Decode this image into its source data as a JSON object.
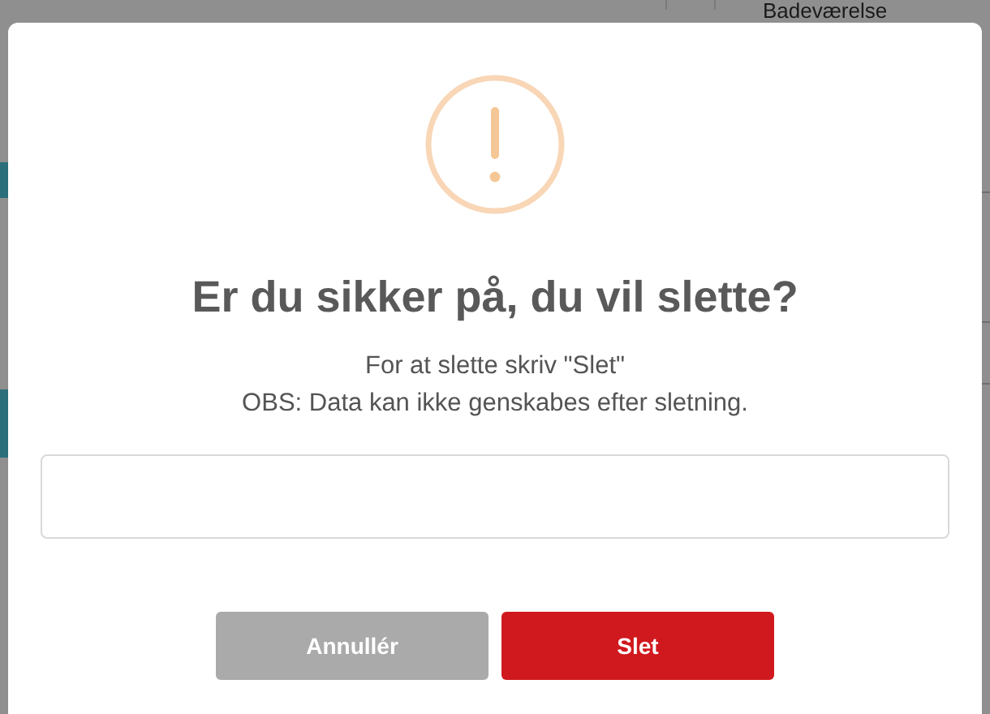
{
  "background": {
    "room_label": "Badeværelse"
  },
  "dialog": {
    "title": "Er du sikker på, du vil slette?",
    "message_lines": [
      "For at slette skriv \"Slet\"",
      "OBS: Data kan ikke genskabes efter sletning."
    ],
    "buttons": [
      {
        "label": "Annullér",
        "kind": "cancel"
      },
      {
        "label": "Slet",
        "kind": "delete"
      }
    ]
  }
}
